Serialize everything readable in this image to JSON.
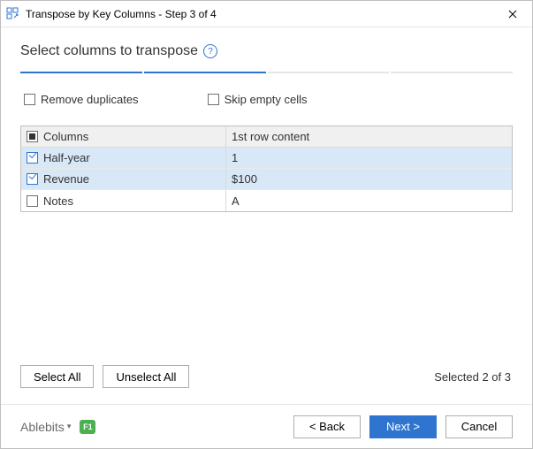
{
  "window": {
    "title": "Transpose by Key Columns - Step 3 of 4"
  },
  "heading": "Select columns to transpose",
  "progress": {
    "total": 4,
    "current": 3,
    "completed": 2
  },
  "options": {
    "remove_duplicates_label": "Remove duplicates",
    "skip_empty_label": "Skip empty cells"
  },
  "table": {
    "header_col1": "Columns",
    "header_col2": "1st row content",
    "rows": [
      {
        "name": "Half-year",
        "first": "1",
        "checked": true
      },
      {
        "name": "Revenue",
        "first": "$100",
        "checked": true
      },
      {
        "name": "Notes",
        "first": "A",
        "checked": false
      }
    ]
  },
  "buttons": {
    "select_all": "Select All",
    "unselect_all": "Unselect All",
    "back": "< Back",
    "next": "Next >",
    "cancel": "Cancel"
  },
  "status": "Selected 2 of 3",
  "brand": "Ablebits",
  "f1_label": "F1"
}
